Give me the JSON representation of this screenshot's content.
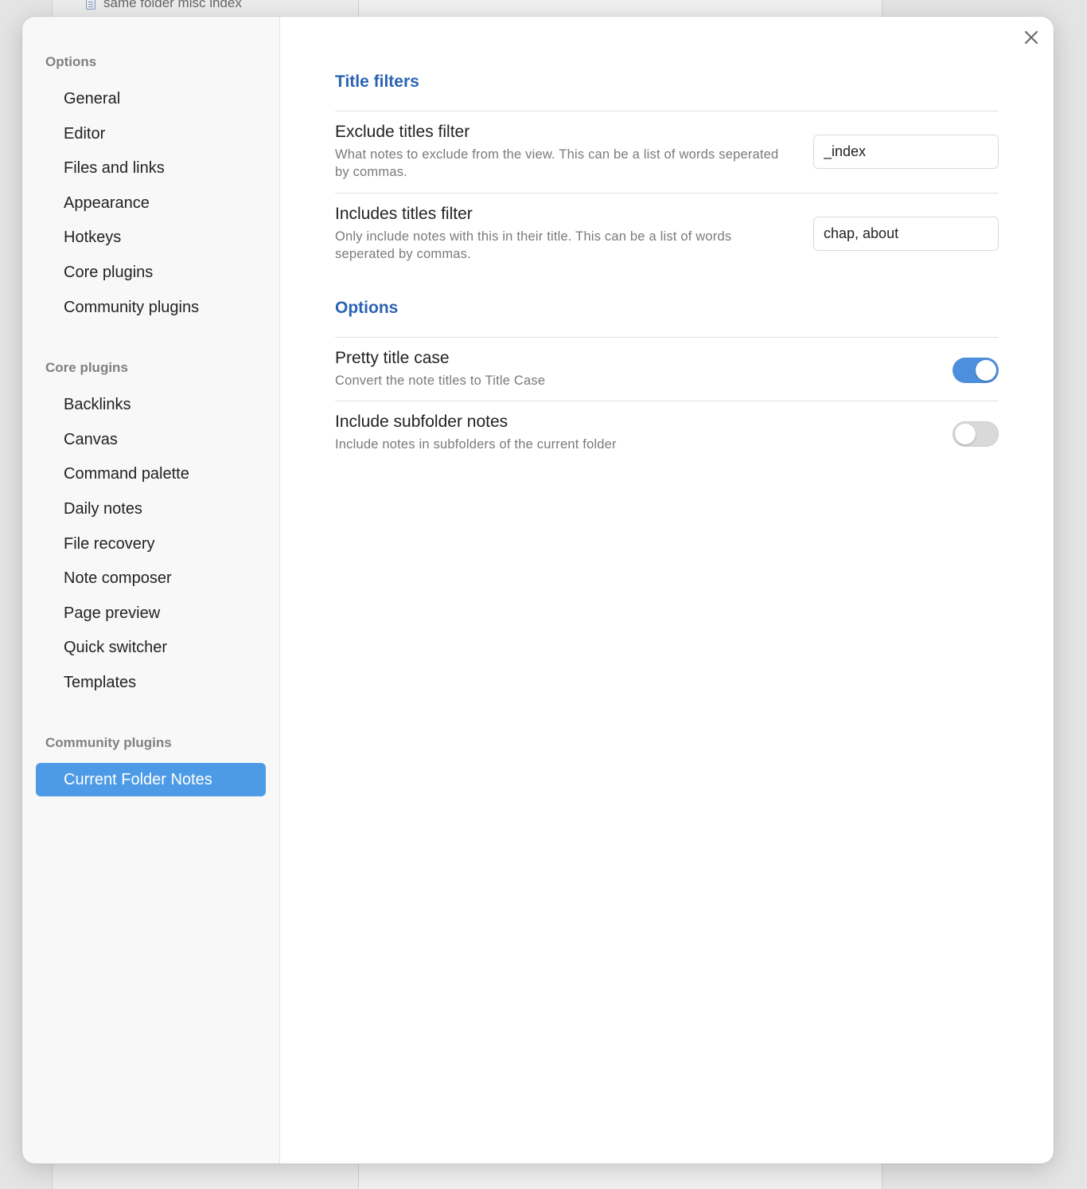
{
  "background": {
    "file_label": "same folder misc index"
  },
  "sidebar": {
    "groups": [
      {
        "heading": "Options",
        "items": [
          "General",
          "Editor",
          "Files and links",
          "Appearance",
          "Hotkeys",
          "Core plugins",
          "Community plugins"
        ]
      },
      {
        "heading": "Core plugins",
        "items": [
          "Backlinks",
          "Canvas",
          "Command palette",
          "Daily notes",
          "File recovery",
          "Note composer",
          "Page preview",
          "Quick switcher",
          "Templates"
        ]
      },
      {
        "heading": "Community plugins",
        "items": [
          "Current Folder Notes"
        ],
        "active": "Current Folder Notes"
      }
    ]
  },
  "content": {
    "sections": [
      {
        "title": "Title filters",
        "settings": [
          {
            "name": "Exclude titles filter",
            "description": "What notes to exclude from the view. This can be a list of words seperated by commas.",
            "value": "_index"
          },
          {
            "name": "Includes titles filter",
            "description": "Only include notes with this in their title. This can be a list of words seperated by commas.",
            "value": "chap, about"
          }
        ]
      },
      {
        "title": "Options",
        "settings": [
          {
            "name": "Pretty title case",
            "description": "Convert the note titles to Title Case",
            "toggle": "on"
          },
          {
            "name": "Include subfolder notes",
            "description": "Include notes in subfolders of the current folder",
            "toggle": "off"
          }
        ]
      }
    ]
  },
  "icons": {
    "close": "close-icon",
    "file": "file-icon"
  },
  "colors": {
    "accent": "#4d9be6",
    "heading": "#2a63b4",
    "toggle_on": "#4d8fdc"
  }
}
